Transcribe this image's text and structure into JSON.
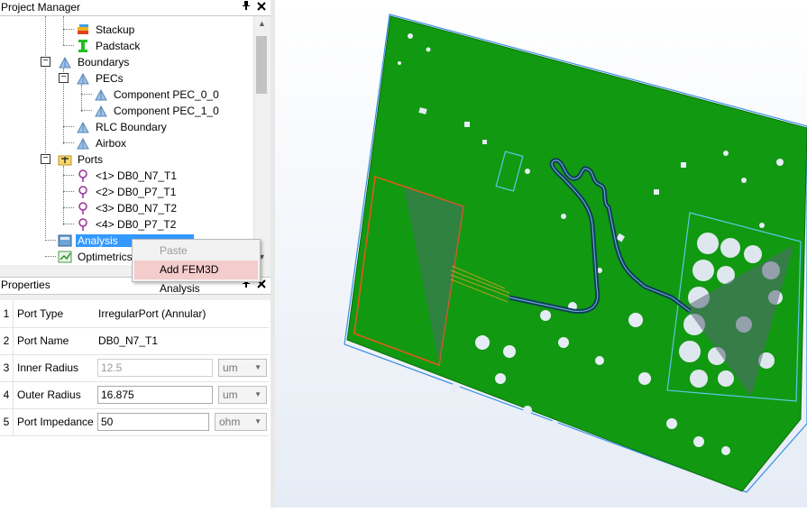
{
  "project_manager": {
    "title": "Project Manager",
    "pin_icon": "pin-icon",
    "close_icon": "close-icon",
    "tree": [
      {
        "label": "Stackup",
        "icon": "stackup-icon"
      },
      {
        "label": "Padstack",
        "icon": "padstack-icon"
      },
      {
        "label": "Boundarys",
        "icon": "boundary-icon"
      },
      {
        "label": "PECs",
        "icon": "boundary-icon"
      },
      {
        "label": "Component PEC_0_0",
        "icon": "boundary-icon"
      },
      {
        "label": "Component PEC_1_0",
        "icon": "boundary-icon"
      },
      {
        "label": "RLC Boundary",
        "icon": "boundary-icon"
      },
      {
        "label": "Airbox",
        "icon": "boundary-icon"
      },
      {
        "label": "Ports",
        "icon": "ports-folder-icon"
      },
      {
        "label": "<1> DB0_N7_T1",
        "icon": "port-icon"
      },
      {
        "label": "<2> DB0_P7_T1",
        "icon": "port-icon"
      },
      {
        "label": "<3> DB0_N7_T2",
        "icon": "port-icon"
      },
      {
        "label": "<4> DB0_P7_T2",
        "icon": "port-icon"
      },
      {
        "label": "Analysis",
        "icon": "analysis-icon",
        "selected": true
      },
      {
        "label": "Optimetrics",
        "icon": "optimetrics-icon"
      }
    ]
  },
  "context_menu": {
    "items": [
      {
        "label": "Paste",
        "enabled": false
      },
      {
        "label": "Add FEM3D Analysis",
        "enabled": true,
        "highlighted": true
      }
    ]
  },
  "properties": {
    "title": "Properties",
    "rows": [
      {
        "num": "1",
        "name": "Port Type",
        "value": "IrregularPort (Annular)"
      },
      {
        "num": "2",
        "name": "Port Name",
        "value": "DB0_N7_T1"
      },
      {
        "num": "3",
        "name": "Inner Radius",
        "value": "12.5",
        "unit": "um",
        "disabled": true
      },
      {
        "num": "4",
        "name": "Outer Radius",
        "value": "16.875",
        "unit": "um"
      },
      {
        "num": "5",
        "name": "Port Impedance",
        "value": "50",
        "unit": "ohm"
      }
    ]
  },
  "colors": {
    "board_green": "#119911",
    "selection_blue": "#3399ff",
    "menu_highlight": "#f4cccc",
    "port_outline": "#e05a1a",
    "airbox_cyan": "#5bc8e6"
  }
}
